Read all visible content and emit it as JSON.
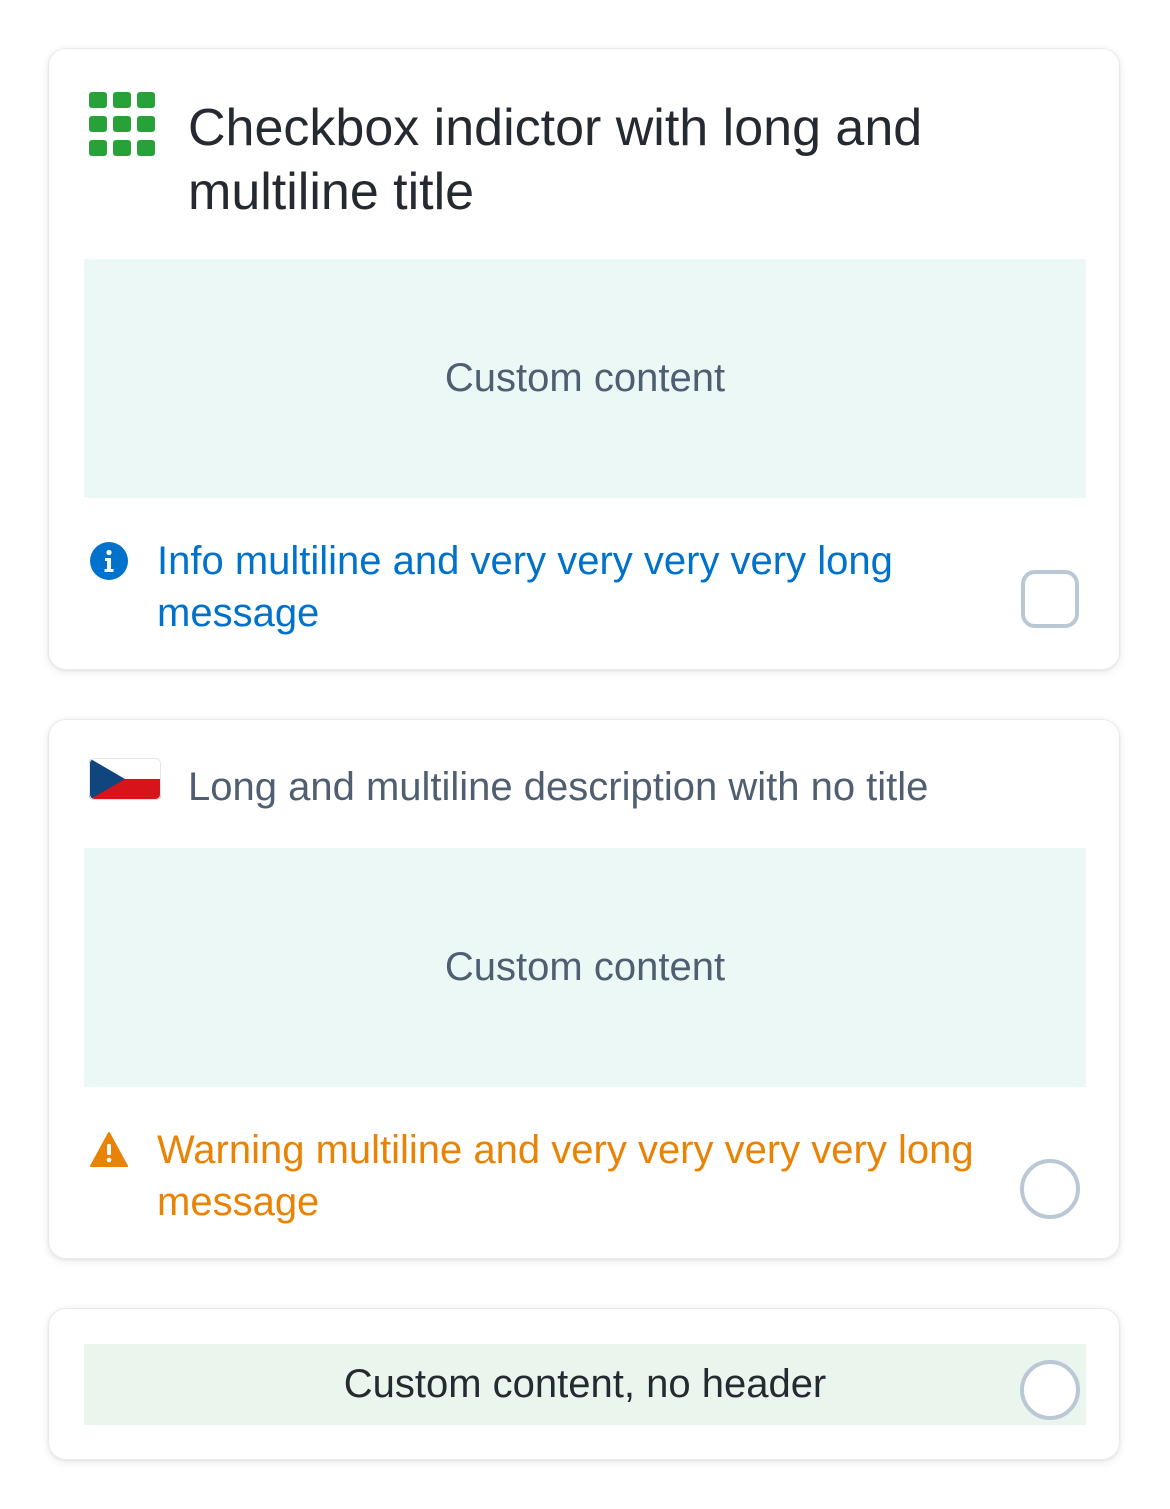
{
  "cards": [
    {
      "icon": "grid-icon",
      "title": "Checkbox indictor with long and multiline title",
      "content": "Custom content",
      "message": {
        "type": "info",
        "icon": "info-icon",
        "text": "Info multiline and very very very very long message"
      },
      "indicator": "checkbox",
      "checked": false
    },
    {
      "icon": "czech-flag-icon",
      "description": "Long and multiline description with no title",
      "content": "Custom content",
      "message": {
        "type": "warning",
        "icon": "warning-icon",
        "text": "Warning multiline and very very very very long message"
      },
      "indicator": "radio",
      "checked": false
    },
    {
      "content": "Custom content, no header",
      "indicator": "radio",
      "checked": false
    }
  ],
  "colors": {
    "icon_green": "#28a138",
    "info_blue": "#0172cb",
    "warning_orange": "#e98305",
    "content_teal_bg": "#ebf8f5",
    "content_green_bg": "#eaf5ed",
    "indicator_border": "#bac7d5",
    "flag_blue": "#11457e",
    "flag_red": "#d7141a"
  }
}
